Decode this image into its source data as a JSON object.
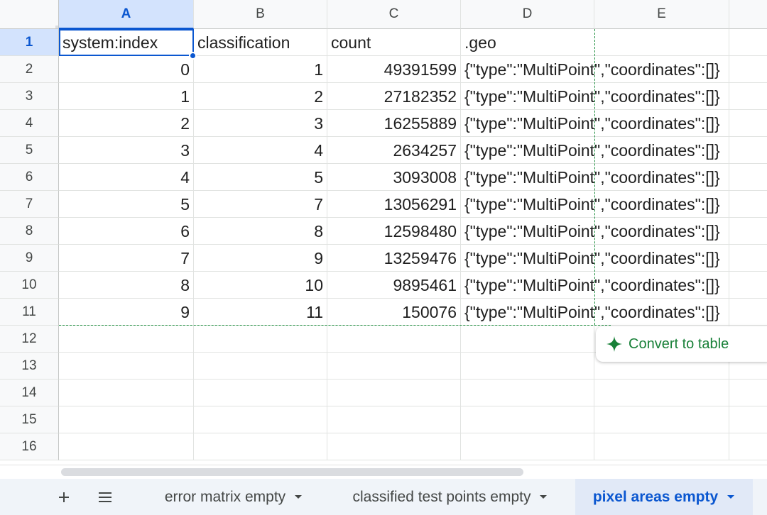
{
  "columns": [
    "A",
    "B",
    "C",
    "D",
    "E"
  ],
  "rows": [
    "1",
    "2",
    "3",
    "4",
    "5",
    "6",
    "7",
    "8",
    "9",
    "10",
    "11",
    "12",
    "13",
    "14",
    "15",
    "16"
  ],
  "header_row": [
    "system:index",
    "classification",
    "count",
    ".geo"
  ],
  "data_rows": [
    [
      "0",
      "1",
      "49391599",
      "{\"type\":\"MultiPoint\",\"coordinates\":[]}"
    ],
    [
      "1",
      "2",
      "27182352",
      "{\"type\":\"MultiPoint\",\"coordinates\":[]}"
    ],
    [
      "2",
      "3",
      "16255889",
      "{\"type\":\"MultiPoint\",\"coordinates\":[]}"
    ],
    [
      "3",
      "4",
      "2634257",
      "{\"type\":\"MultiPoint\",\"coordinates\":[]}"
    ],
    [
      "4",
      "5",
      "3093008",
      "{\"type\":\"MultiPoint\",\"coordinates\":[]}"
    ],
    [
      "5",
      "7",
      "13056291",
      "{\"type\":\"MultiPoint\",\"coordinates\":[]}"
    ],
    [
      "6",
      "8",
      "12598480",
      "{\"type\":\"MultiPoint\",\"coordinates\":[]}"
    ],
    [
      "7",
      "9",
      "13259476",
      "{\"type\":\"MultiPoint\",\"coordinates\":[]}"
    ],
    [
      "8",
      "10",
      "9895461",
      "{\"type\":\"MultiPoint\",\"coordinates\":[]}"
    ],
    [
      "9",
      "11",
      "150076",
      "{\"type\":\"MultiPoint\",\"coordinates\":[]}"
    ]
  ],
  "convert_button": {
    "label": "Convert to table",
    "icon": "sparkle-icon"
  },
  "sheet_tabs": [
    {
      "label": "error matrix empty",
      "active": false
    },
    {
      "label": "classified test points empty",
      "active": false
    },
    {
      "label": "pixel areas empty",
      "active": true
    }
  ],
  "toolbar": {
    "add_icon": "plus-icon",
    "list_icon": "menu-icon"
  },
  "colors": {
    "accent": "#0b57d0",
    "selected_header": "#d3e3fd",
    "convert_green": "#188038"
  }
}
